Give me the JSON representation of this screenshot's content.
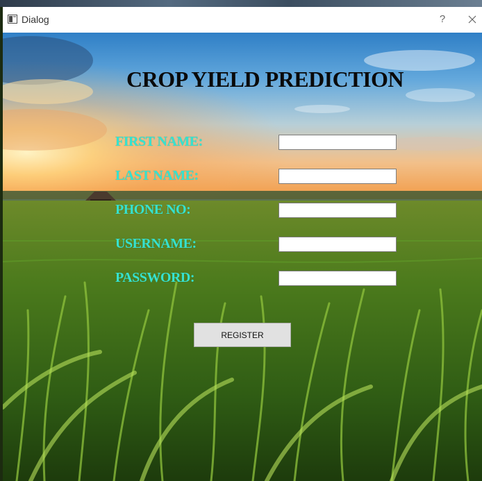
{
  "window": {
    "title": "Dialog",
    "help_label": "?"
  },
  "form": {
    "heading": "CROP YIELD PREDICTION",
    "fields": [
      {
        "label": "FIRST NAME:",
        "value": ""
      },
      {
        "label": "LAST NAME:",
        "value": ""
      },
      {
        "label": "PHONE NO:",
        "value": ""
      },
      {
        "label": "USERNAME:",
        "value": ""
      },
      {
        "label": "PASSWORD:",
        "value": ""
      }
    ],
    "register_label": "REGISTER"
  },
  "colors": {
    "label_color": "#36e2cf",
    "heading_color": "#0a0a0a",
    "button_bg": "#e1e1e1"
  },
  "icons": {
    "app": "dialog-window-icon",
    "help": "question-mark-icon",
    "close": "close-x-icon"
  }
}
